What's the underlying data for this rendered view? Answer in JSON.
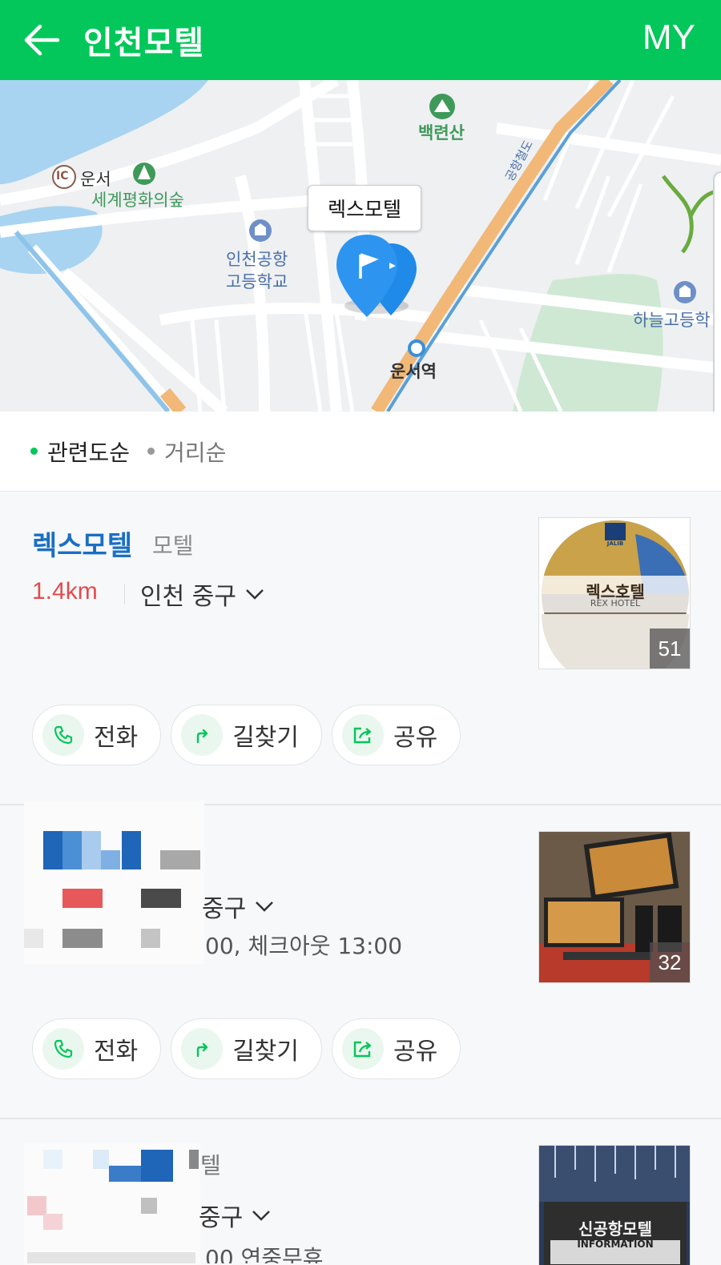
{
  "header": {
    "title": "인천모텔",
    "my_label": "MY"
  },
  "map": {
    "labels": {
      "mountain": "백련산",
      "ic_badge": "IC",
      "ic_name": "운서",
      "forest": "세계평화의숲",
      "school1_line1": "인천공항",
      "school1_line2": "고등학교",
      "road": "공항철도",
      "station": "운서역",
      "school2": "하늘고등학"
    },
    "marker": "렉스모텔"
  },
  "sort": {
    "active": "관련도순",
    "inactive": "거리순"
  },
  "results": [
    {
      "name": "렉스모텔",
      "category": "모텔",
      "distance": "1.4km",
      "area": "인천 중구",
      "thumb_sign": "렉스호텔",
      "thumb_sign_sub": "REX HOTEL",
      "thumb_logo": "JALIB",
      "photo_count": "51",
      "actions": [
        "전화",
        "길찾기",
        "공유"
      ]
    },
    {
      "area_partial": "중구",
      "info_partial": "00, 체크아웃 13:00",
      "photo_count": "32",
      "actions": [
        "전화",
        "길찾기",
        "공유"
      ]
    },
    {
      "category_partial": "텔",
      "area_partial": "중구",
      "info_partial": "00 연중무휴",
      "thumb_sign": "신공항모텔",
      "thumb_sign_sub": "INFORMATION"
    }
  ],
  "colors": {
    "brand_green": "#03c75a",
    "link_blue": "#1a6fc4",
    "distance_red": "#e24b4b"
  },
  "icons": [
    "back-arrow-icon",
    "phone-icon",
    "directions-icon",
    "share-icon",
    "chevron-down-icon",
    "map-pin-icon"
  ]
}
